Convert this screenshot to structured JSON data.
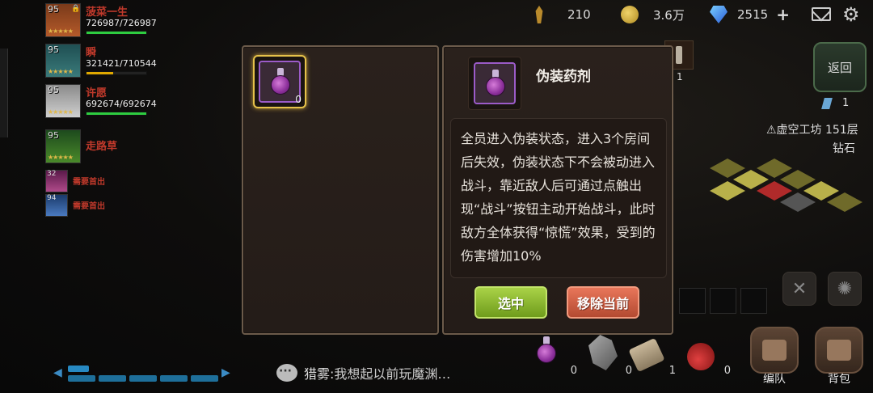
{
  "party": [
    {
      "level": "95",
      "name": "菠菜一生",
      "hp": "726987/726987",
      "hp_fraction": 1.0
    },
    {
      "level": "95",
      "name": "瞬",
      "hp": "321421/710544",
      "hp_fraction": 0.45
    },
    {
      "level": "95",
      "name": "许愿",
      "hp": "692674/692674",
      "hp_fraction": 1.0
    },
    {
      "level": "95",
      "name": "走路草"
    }
  ],
  "small_members": [
    {
      "level": "32",
      "label": "需要首出"
    },
    {
      "level": "94",
      "label": "需要首出"
    }
  ],
  "resources": {
    "wheat": "210",
    "gold": "3.6万",
    "diamond": "2515"
  },
  "right": {
    "back_label": "返回",
    "torch_count": "1",
    "crystal_count": "1",
    "floor": "⚠虚空工坊 151层",
    "floor_sub": "钻石"
  },
  "dialog": {
    "item_count": "0",
    "item_name": "伪装药剂",
    "description": "全员进入伪装状态，进入3个房间后失效，伪装状态下不会被动进入战斗，靠近敌人后可通过点触出现“战斗”按钮主动开始战斗，此时敌方全体获得“惊慌”效果，受到的伤害增加10%",
    "select_label": "选中",
    "remove_label": "移除当前"
  },
  "bottom": {
    "chat_speaker": "猎雾:",
    "chat_text": "我想起以前玩魔渊…",
    "items": [
      "0",
      "0",
      "1",
      "0"
    ],
    "team_label": "编队",
    "bag_label": "背包"
  }
}
